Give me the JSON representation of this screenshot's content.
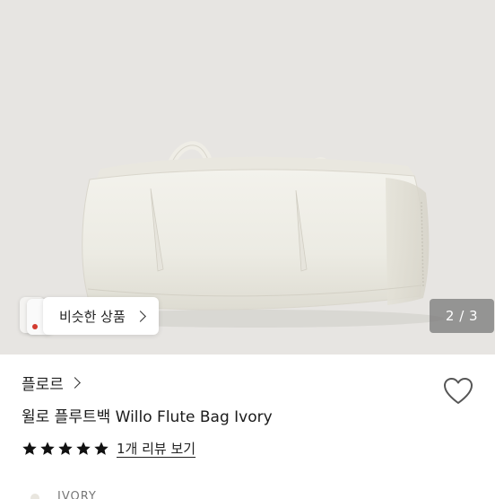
{
  "image": {
    "background_color": "#e7e5e2",
    "subject": "ivory-flute-bag",
    "page_counter": "2 / 3"
  },
  "similar": {
    "button_label": "비슷한 상품",
    "chevron_icon": "chevron-right-icon"
  },
  "product": {
    "brand": "플로르",
    "title": "윌로 플루트백 Willo Flute Bag Ivory",
    "rating": 5,
    "rating_max": 5,
    "review_link": "1개 리뷰 보기",
    "wishlist_icon": "heart-outline-icon",
    "option_peek": "IVORY"
  },
  "colors": {
    "star": "#111111",
    "bag": "#efede5",
    "counter_bg": "#7a7a7a"
  }
}
